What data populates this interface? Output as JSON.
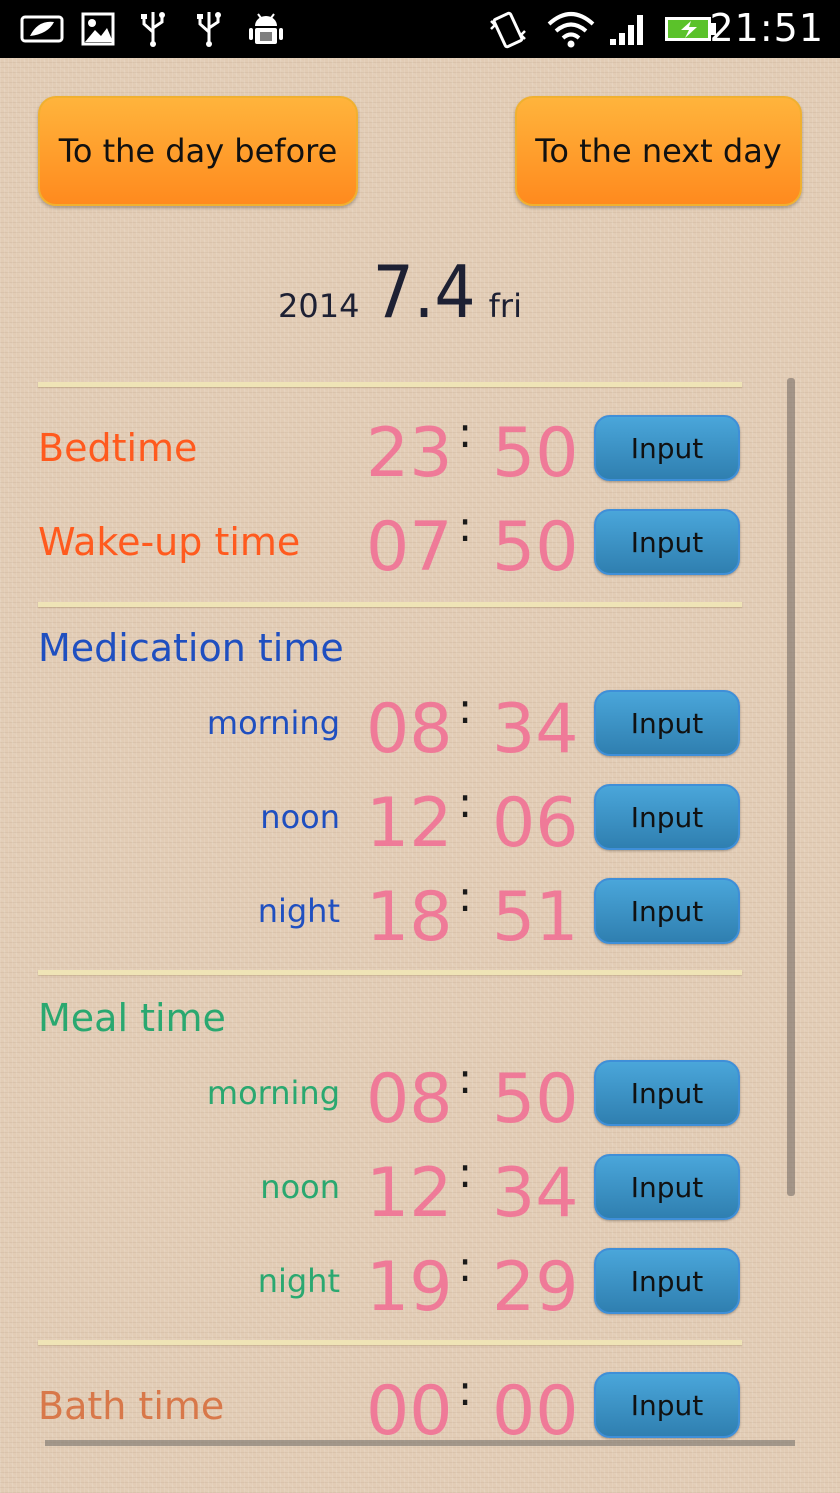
{
  "status_bar": {
    "time": "21:51",
    "left_icons": [
      "notification-leaf-icon",
      "image-icon",
      "usb-icon",
      "usb-icon",
      "android-debug-icon"
    ],
    "right_icons": [
      "vibrate-icon",
      "wifi-icon",
      "signal-icon",
      "battery-charging-icon"
    ]
  },
  "nav": {
    "prev_label": "To the day before",
    "next_label": "To the next day"
  },
  "date": {
    "year": "2014",
    "day": "7.4",
    "weekday": "fri"
  },
  "sleep": {
    "bedtime": {
      "label": "Bedtime",
      "hh": "23",
      "mm": "50",
      "button": "Input"
    },
    "wakeup": {
      "label": "Wake-up time",
      "hh": "07",
      "mm": "50",
      "button": "Input"
    }
  },
  "medication": {
    "title": "Medication time",
    "morning": {
      "label": "morning",
      "hh": "08",
      "mm": "34",
      "button": "Input"
    },
    "noon": {
      "label": "noon",
      "hh": "12",
      "mm": "06",
      "button": "Input"
    },
    "night": {
      "label": "night",
      "hh": "18",
      "mm": "51",
      "button": "Input"
    }
  },
  "meal": {
    "title": "Meal time",
    "morning": {
      "label": "morning",
      "hh": "08",
      "mm": "50",
      "button": "Input"
    },
    "noon": {
      "label": "noon",
      "hh": "12",
      "mm": "34",
      "button": "Input"
    },
    "night": {
      "label": "night",
      "hh": "19",
      "mm": "29",
      "button": "Input"
    }
  },
  "bath": {
    "label": "Bath time",
    "hh": "00",
    "mm": "00",
    "button": "Input"
  },
  "colors": {
    "orange_label": "#ff5a1e",
    "blue_label": "#1f4fc0",
    "green_label": "#2aa870",
    "time_digits": "#ef7a98",
    "nav_button": "#ff9a2a",
    "input_button": "#3a8fc4"
  }
}
